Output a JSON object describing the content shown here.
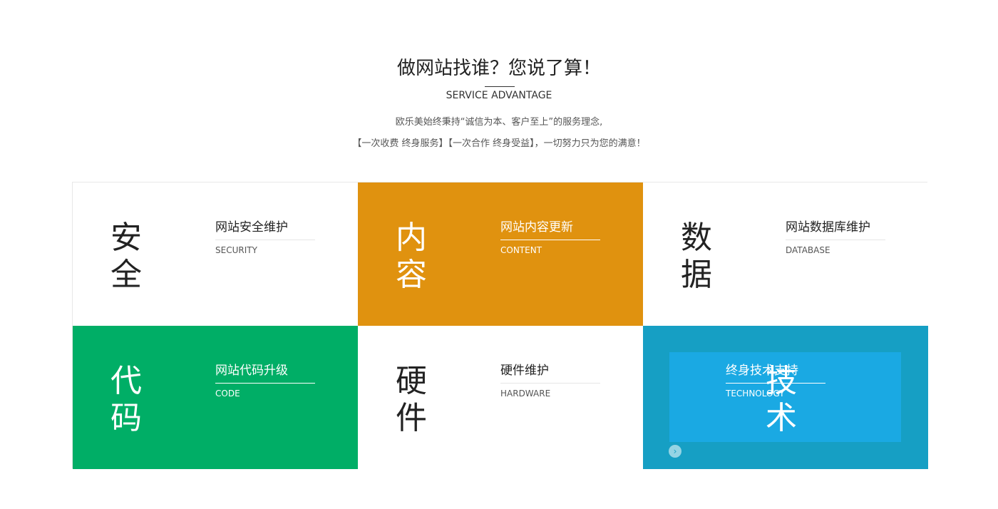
{
  "section": {
    "title": "做网站找谁？您说了算！",
    "subtitle": "SERVICE ADVANTAGE",
    "desc_line1": "欧乐美始终秉持“诚信为本、客户至上”的服务理念,",
    "desc_line2": "【一次收费 终身服务】【一次合作 终身受益】，一切努力只为您的满意！"
  },
  "cards": [
    {
      "big_char1": "安",
      "big_char2": "全",
      "title": "网站安全维护",
      "en": "SECURITY",
      "bg_color": "#ffffff",
      "theme": "light"
    },
    {
      "big_char1": "内",
      "big_char2": "容",
      "title": "网站内容更新",
      "en": "CONTENT",
      "bg_color": "#e0920f",
      "theme": "dark"
    },
    {
      "big_char1": "数",
      "big_char2": "据",
      "title": "网站数据库维护",
      "en": "DATABASE",
      "bg_color": "#ffffff",
      "theme": "light"
    },
    {
      "big_char1": "代",
      "big_char2": "码",
      "title": "网站代码升级",
      "en": "CODE",
      "bg_color": "#00ae66",
      "theme": "dark"
    },
    {
      "big_char1": "硬",
      "big_char2": "件",
      "title": "硬件维护",
      "en": "HARDWARE",
      "bg_color": "#ffffff",
      "theme": "light"
    },
    {
      "big_char1": "技",
      "big_char2": "术",
      "title": "终身技术支持",
      "en": "TECHNOLOGY",
      "bg_color": "#169fc4",
      "highlight_color": "#1aa9e3",
      "theme": "dark",
      "state": "hover"
    }
  ],
  "icons": {
    "next_arrow": "chevron-right-icon"
  },
  "arrow_glyph": "›"
}
